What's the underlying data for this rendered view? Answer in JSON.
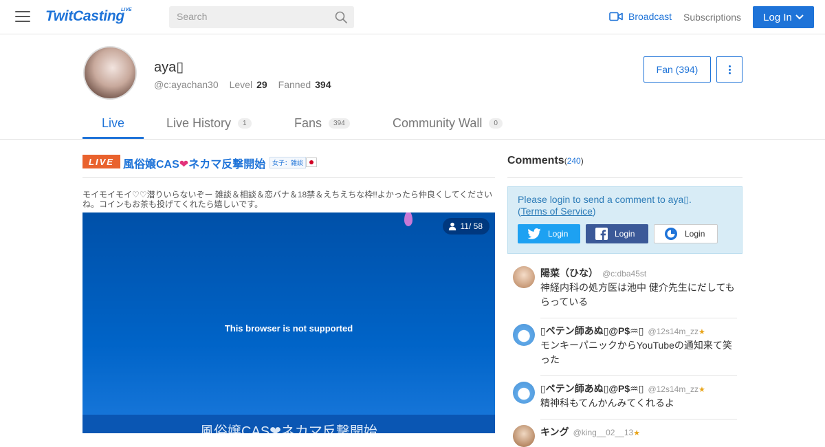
{
  "header": {
    "logo": "TwitCasting",
    "logo_sup": "LIVE",
    "search_placeholder": "Search",
    "broadcast_label": "Broadcast",
    "subscriptions_label": "Subscriptions",
    "login_label": "Log In",
    "accent_color": "#1e73d8"
  },
  "profile": {
    "name": "aya▯",
    "handle": "@c:ayachan30",
    "level_label": "Level",
    "level": "29",
    "fanned_label": "Fanned",
    "fanned": "394",
    "fan_button": "Fan (394)"
  },
  "tabs": [
    {
      "label": "Live",
      "count": ""
    },
    {
      "label": "Live History",
      "count": "1"
    },
    {
      "label": "Fans",
      "count": "394"
    },
    {
      "label": "Community Wall",
      "count": "0"
    }
  ],
  "live": {
    "badge": "LIVE",
    "title_part1": "風俗嬢CAS",
    "title_heart": "❤",
    "title_part2": "ネカマ反撃開始",
    "category": "女子：雑談",
    "description": "モイモイモイ♡♡潜りいらないぞー 雑談＆相談＆恋バナ＆18禁＆えちえちな枠!!よかったら仲良くしてくださいね。コインもお茶も投げてくれたら嬉しいです。",
    "viewers": "11/ 58",
    "unsupported_msg": "This browser is not supported",
    "player_title": "風俗嬢CAS❤ネカマ反撃開始",
    "badge_color": "#e9622d"
  },
  "comments": {
    "heading": "Comments",
    "count": "240",
    "login_msg_prefix": "Please login to send a comment to aya▯.",
    "tos_label": "Terms of Service",
    "sns": [
      {
        "name": "twitter",
        "label": "Login"
      },
      {
        "name": "facebook",
        "label": "Login"
      },
      {
        "name": "twitcasting",
        "label": "Login"
      }
    ],
    "items": [
      {
        "name": "陽菜（ひな）",
        "id": "@c:dba45st",
        "text": "神経内科の処方医は池中 健介先生にだしてもらっている"
      },
      {
        "name": "▯ペテン師あぬ▯@P$♒▯",
        "id": "@12s14m_zz",
        "text": "モンキーパニックからYouTubeの通知来て笑った"
      },
      {
        "name": "▯ペテン師あぬ▯@P$♒▯",
        "id": "@12s14m_zz",
        "text": "精神科もてんかんみてくれるよ"
      },
      {
        "name": "キング",
        "id": "@king__02__13",
        "text": ""
      }
    ]
  }
}
